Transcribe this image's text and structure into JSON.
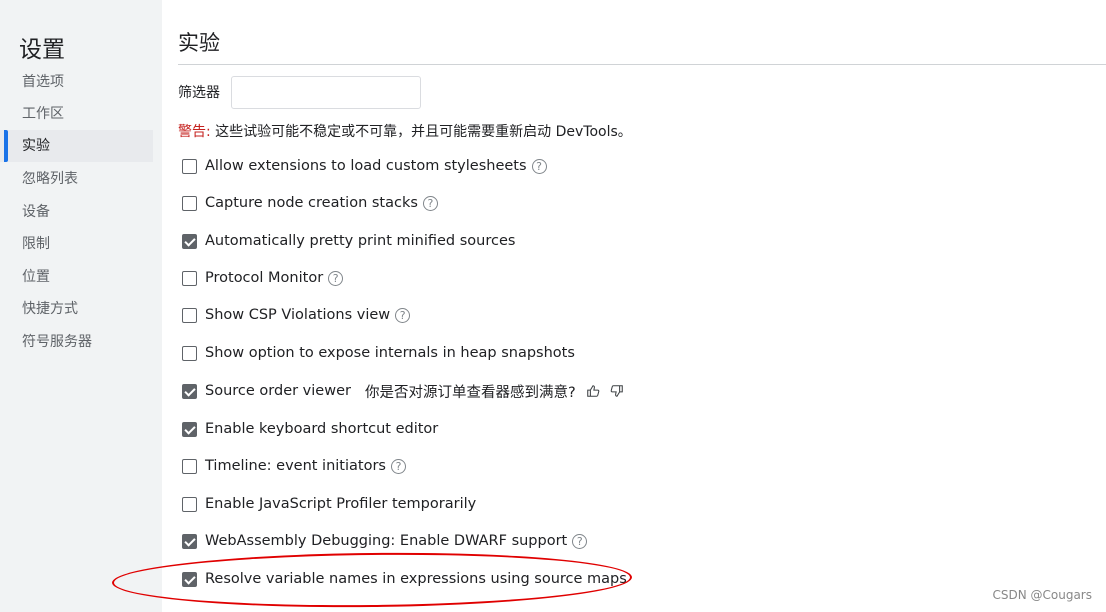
{
  "sidebar": {
    "title": "设置",
    "items": [
      {
        "label": "首选项"
      },
      {
        "label": "工作区"
      },
      {
        "label": "实验",
        "selected": true
      },
      {
        "label": "忽略列表"
      },
      {
        "label": "设备"
      },
      {
        "label": "限制"
      },
      {
        "label": "位置"
      },
      {
        "label": "快捷方式"
      },
      {
        "label": "符号服务器"
      }
    ]
  },
  "main": {
    "title": "实验",
    "filter": {
      "label": "筛选器",
      "value": "",
      "placeholder": ""
    },
    "warning": {
      "label": "警告:",
      "text": " 这些试验可能不稳定或不可靠，并且可能需要重新启动 DevTools。"
    },
    "accent_color": "#1a73e8",
    "warning_color": "#c5221f",
    "experiments": [
      {
        "label": "Allow extensions to load custom stylesheets",
        "checked": false,
        "help": true
      },
      {
        "label": "Capture node creation stacks",
        "checked": false,
        "help": true
      },
      {
        "label": "Automatically pretty print minified sources",
        "checked": true,
        "help": false
      },
      {
        "label": "Protocol Monitor",
        "checked": false,
        "help": true
      },
      {
        "label": "Show CSP Violations view",
        "checked": false,
        "help": true
      },
      {
        "label": "Show option to expose internals in heap snapshots",
        "checked": false,
        "help": false
      },
      {
        "label": "Source order viewer",
        "checked": true,
        "help": false,
        "survey": "你是否对源订单查看器感到满意?"
      },
      {
        "label": "Enable keyboard shortcut editor",
        "checked": true,
        "help": false
      },
      {
        "label": "Timeline: event initiators",
        "checked": false,
        "help": true
      },
      {
        "label": "Enable JavaScript Profiler temporarily",
        "checked": false,
        "help": false
      },
      {
        "label": "WebAssembly Debugging: Enable DWARF support",
        "checked": true,
        "help": true
      },
      {
        "label": "Resolve variable names in expressions using source maps",
        "checked": true,
        "help": false
      }
    ]
  },
  "annotation_color": "#e00000",
  "watermark": "CSDN @Cougars"
}
